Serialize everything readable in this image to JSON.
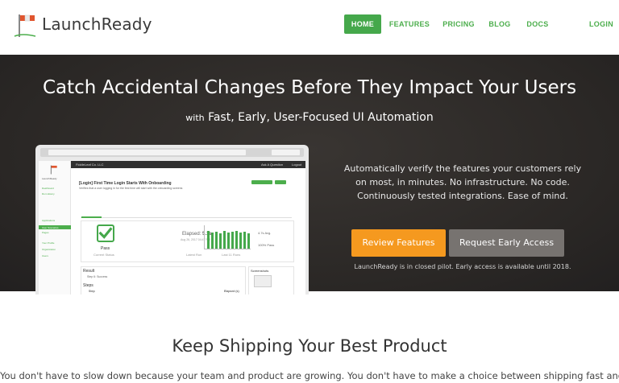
{
  "brand": {
    "name": "LaunchReady"
  },
  "nav": {
    "items": [
      {
        "label": "HOME",
        "active": true
      },
      {
        "label": "FEATURES",
        "active": false
      },
      {
        "label": "PRICING",
        "active": false
      },
      {
        "label": "BLOG",
        "active": false
      },
      {
        "label": "DOCS",
        "active": false
      }
    ],
    "login": "LOGIN"
  },
  "hero": {
    "title": "Catch Accidental Changes Before They Impact Your Users",
    "subtitle_prefix": "with",
    "subtitle": "Fast, Early, User-Focused UI Automation",
    "description": "Automatically verify the features your customers rely on most, in minutes. No infrastructure. No code. Continuously tested integrations. Ease of mind.",
    "review_button": "Review Features",
    "early_access_button": "Request Early Access",
    "pilot_note": "LaunchReady is in closed pilot. Early access is available until 2018."
  },
  "mockup": {
    "company": "FiddleLeaf Co. LLC",
    "top_links": [
      "Ask A Question",
      "Logout"
    ],
    "sidebar": [
      "LaunchReady",
      "Dashboard",
      "Run History",
      "Applications",
      "User Scenarios",
      "Pages",
      "Your Profile",
      "Organization",
      "Users"
    ],
    "test_title": "[Login] First Time Login Starts With Onboarding",
    "test_desc": "Verifies that a user logging in for the first time will start with the onboarding screens",
    "status": "Pass",
    "current_status_label": "Current Status",
    "elapsed_label": "Elapsed:",
    "elapsed_value": "5.1s",
    "run_date": "Aug 26, 2017 04:47 PM",
    "latest_run_label": "Latest Run",
    "avg_label": "4.7s Avg.",
    "pass_pct": "100% Pass",
    "last_runs_label": "Last 11 Runs",
    "result_label": "Result",
    "result_text": "Step 6: Success",
    "steps_label": "Steps",
    "step_col": "Step",
    "elapsed_col": "Elapsed (s)",
    "screenshots_label": "Screenshots"
  },
  "section": {
    "title": "Keep Shipping Your Best Product",
    "body": "You don't have to slow down because your team and product are growing. You don't have to make a choice between shipping fast and a"
  },
  "colors": {
    "accent_green": "#45a84b",
    "accent_orange": "#f5991f",
    "hero_bg": "#2b2826",
    "gray_button": "#777370"
  }
}
